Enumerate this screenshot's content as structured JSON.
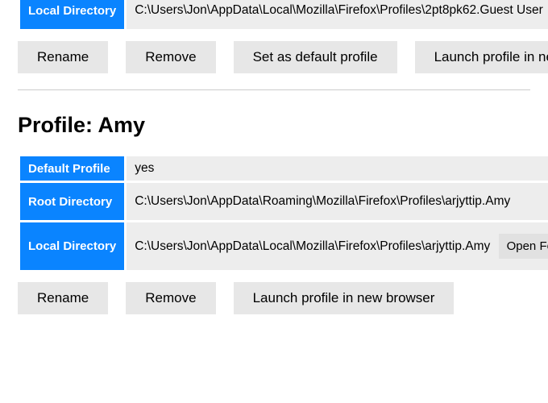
{
  "profiles": [
    {
      "rows": [
        {
          "label": "",
          "value": ""
        },
        {
          "label": "Local Directory",
          "value": "C:\\Users\\Jon\\AppData\\Local\\Mozilla\\Firefox\\Profiles\\2pt8pk62.Guest User"
        }
      ],
      "buttons": [
        "Rename",
        "Remove",
        "Set as default profile",
        "Launch profile in new browser"
      ]
    },
    {
      "title": "Profile: Amy",
      "rows": [
        {
          "label": "Default Profile",
          "value": "yes",
          "thin": true
        },
        {
          "label": "Root Directory",
          "value": "C:\\Users\\Jon\\AppData\\Roaming\\Mozilla\\Firefox\\Profiles\\arjyttip.Amy"
        },
        {
          "label": "Local Directory",
          "value": "C:\\Users\\Jon\\AppData\\Local\\Mozilla\\Firefox\\Profiles\\arjyttip.Amy",
          "inline_button": "Open Folder"
        }
      ],
      "buttons": [
        "Rename",
        "Remove",
        "Launch profile in new browser"
      ]
    }
  ]
}
